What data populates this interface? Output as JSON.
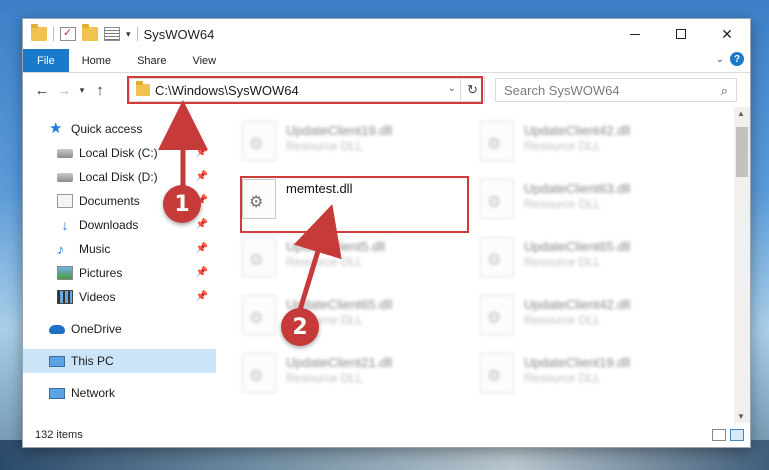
{
  "window": {
    "title": "SysWOW64",
    "controls": {
      "minimize": "minimize",
      "maximize": "maximize",
      "close": "✕"
    }
  },
  "ribbon": {
    "tabs": [
      {
        "label": "File"
      },
      {
        "label": "Home"
      },
      {
        "label": "Share"
      },
      {
        "label": "View"
      }
    ]
  },
  "address": {
    "path": "C:\\Windows\\SysWOW64"
  },
  "search": {
    "placeholder": "Search SysWOW64"
  },
  "sidebar": {
    "items": [
      {
        "label": "Quick access",
        "icon": "star-icon"
      },
      {
        "label": "Local Disk (C:)",
        "icon": "disk-icon"
      },
      {
        "label": "Local Disk (D:)",
        "icon": "disk-icon"
      },
      {
        "label": "Documents",
        "icon": "documents-icon"
      },
      {
        "label": "Downloads",
        "icon": "downloads-icon"
      },
      {
        "label": "Music",
        "icon": "music-icon"
      },
      {
        "label": "Pictures",
        "icon": "pictures-icon"
      },
      {
        "label": "Videos",
        "icon": "videos-icon"
      },
      {
        "label": "OneDrive",
        "icon": "onedrive-icon"
      },
      {
        "label": "This PC",
        "icon": "pc-icon"
      },
      {
        "label": "Network",
        "icon": "network-icon"
      }
    ]
  },
  "files": [
    {
      "name": "UpdateClient19.dll",
      "type": "Resource DLL"
    },
    {
      "name": "UpdateClient42.dll",
      "type": "Resource DLL"
    },
    {
      "name": "memtest.dll",
      "type": ""
    },
    {
      "name": "UpdateClient63.dll",
      "type": "Resource DLL"
    },
    {
      "name": "UpdateClient5.dll",
      "type": "Resource DLL"
    },
    {
      "name": "UpdateClient65.dll",
      "type": "Resource DLL"
    },
    {
      "name": "UpdateClient65.dll",
      "type": "Resource DLL"
    },
    {
      "name": "UpdateClient42.dll",
      "type": "Resource DLL"
    },
    {
      "name": "UpdateClient21.dll",
      "type": "Resource DLL"
    },
    {
      "name": "UpdateClient19.dll",
      "type": "Resource DLL"
    }
  ],
  "status": {
    "count": "132 items"
  },
  "annotations": {
    "step1": "1",
    "step2": "2",
    "highlight_color": "#d03a3a",
    "callout_color": "#c63a3a"
  },
  "colors": {
    "accent": "#1979ca",
    "selection": "#cce4f7"
  }
}
